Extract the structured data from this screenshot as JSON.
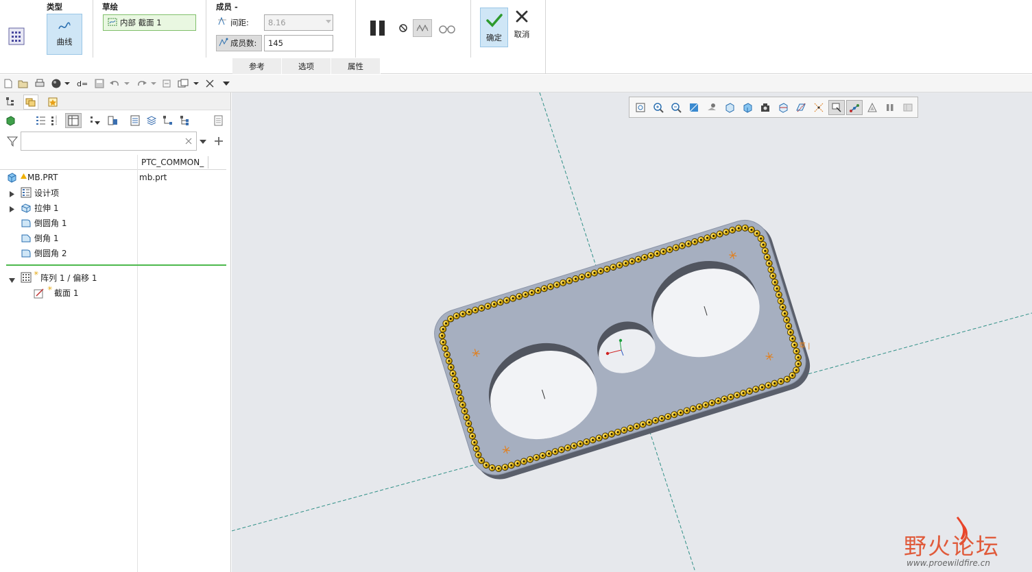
{
  "ribbon": {
    "type_label": "类型",
    "type_button": "曲线",
    "sketch_label": "草绘",
    "sketch_value": "内部 截面 1",
    "members_label": "成员 -",
    "spacing_label": "间距:",
    "spacing_value": "8.16",
    "count_label": "成员数:",
    "count_value": "145",
    "ok_label": "确定",
    "cancel_label": "取消",
    "tabs": [
      "参考",
      "选项",
      "属性"
    ]
  },
  "model_tree": {
    "filter_placeholder": "",
    "column_header": "PTC_COMMON_",
    "root": {
      "name": "MB.PRT",
      "value": "mb.prt"
    },
    "items": [
      {
        "label": "设计项",
        "icon": "design-items-icon"
      },
      {
        "label": "拉伸 1",
        "icon": "extrude-icon"
      },
      {
        "label": "倒圆角 1",
        "icon": "round-icon"
      },
      {
        "label": "倒角 1",
        "icon": "chamfer-icon"
      },
      {
        "label": "倒圆角 2",
        "icon": "round-icon"
      }
    ],
    "pattern": {
      "label": "阵列 1 / 偏移 1",
      "child": "截面 1"
    }
  },
  "viewport": {
    "bg_color": "#e6e8ec",
    "part_color": "#a6afc0",
    "pattern_color": "#f0c21a"
  },
  "watermark": {
    "title": "野火论坛",
    "url": "www.proewildfire.cn"
  },
  "colors": {
    "accent": "#cfe6f6",
    "ok_green": "#2d9a2d"
  }
}
